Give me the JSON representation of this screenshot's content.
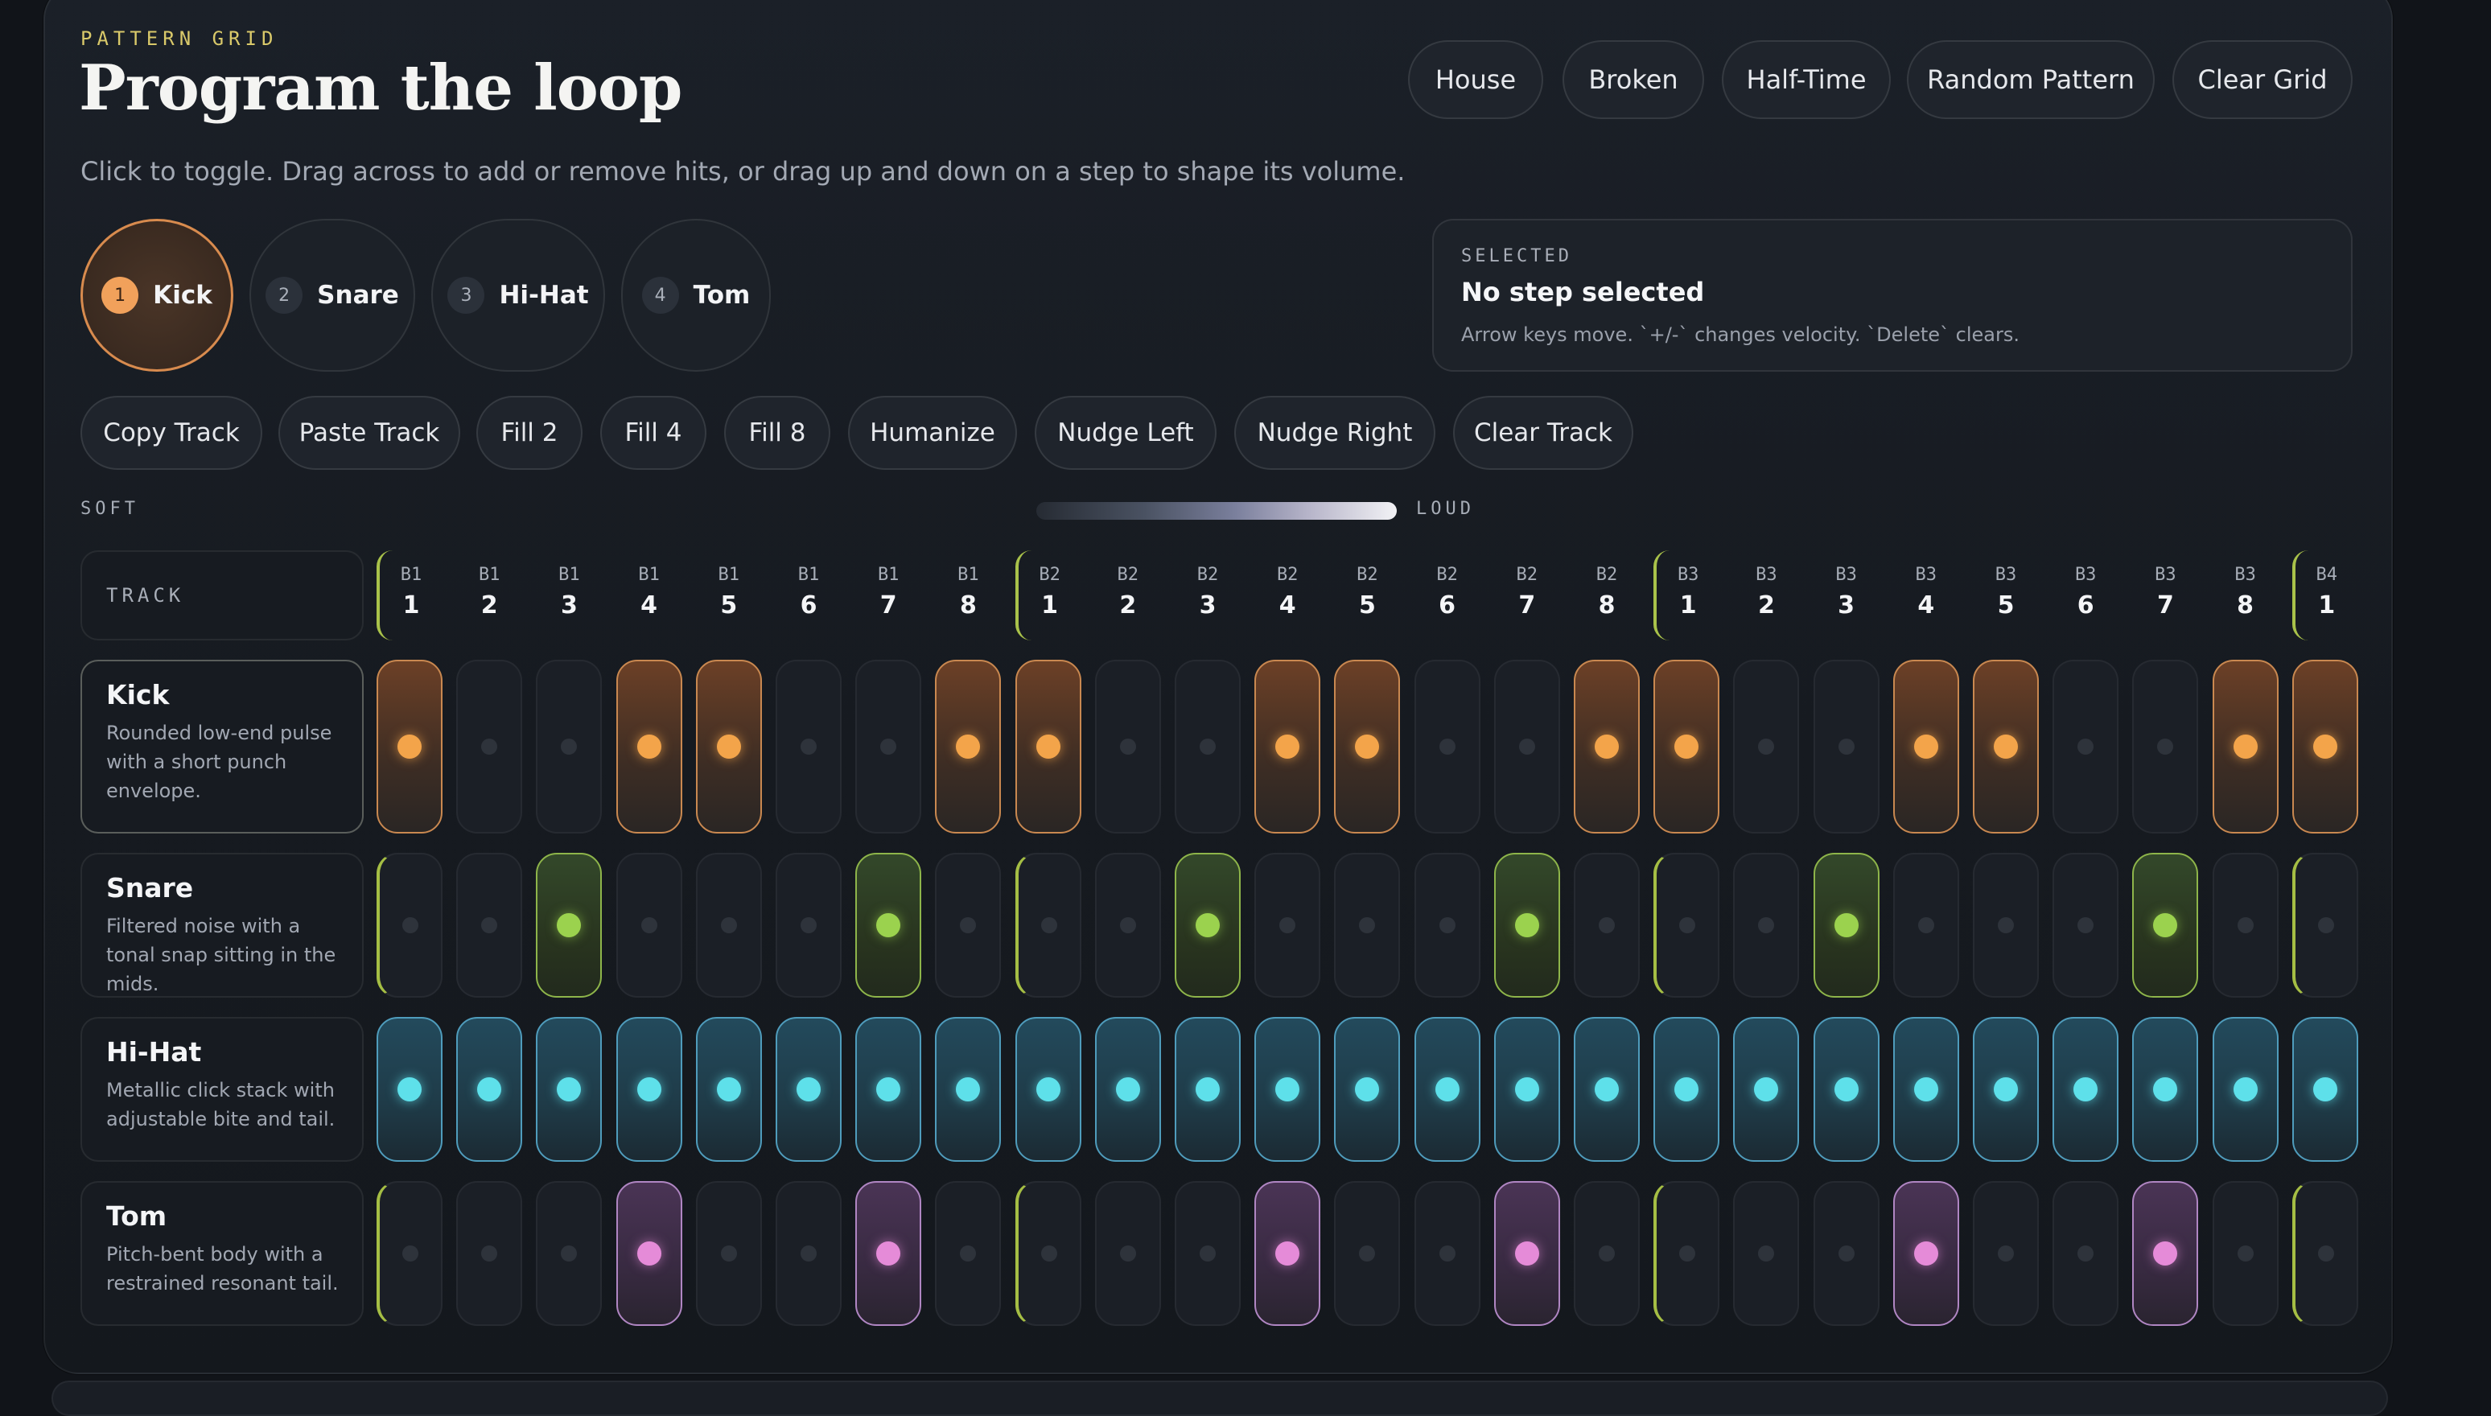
{
  "header": {
    "eyebrow": "PATTERN GRID",
    "title": "Program the loop",
    "subtitle": "Click to toggle. Drag across to add or remove hits, or drag up and down on a step to shape its volume."
  },
  "presets": [
    "House",
    "Broken",
    "Half-Time",
    "Random Pattern",
    "Clear Grid"
  ],
  "track_select": [
    {
      "num": "1",
      "label": "Kick",
      "active": true
    },
    {
      "num": "2",
      "label": "Snare",
      "active": false
    },
    {
      "num": "3",
      "label": "Hi-Hat",
      "active": false
    },
    {
      "num": "4",
      "label": "Tom",
      "active": false
    }
  ],
  "selected": {
    "eyebrow": "SELECTED",
    "title": "No step selected",
    "hint": "Arrow keys move. `+/-` changes velocity. `Delete` clears."
  },
  "track_actions": [
    "Copy Track",
    "Paste Track",
    "Fill 2",
    "Fill 4",
    "Fill 8",
    "Humanize",
    "Nudge Left",
    "Nudge Right",
    "Clear Track"
  ],
  "velocity": {
    "soft_label": "SOFT",
    "loud_label": "LOUD"
  },
  "grid_header_label": "TRACK",
  "steps": [
    {
      "bar": "B1",
      "step": "1"
    },
    {
      "bar": "B1",
      "step": "2"
    },
    {
      "bar": "B1",
      "step": "3"
    },
    {
      "bar": "B1",
      "step": "4"
    },
    {
      "bar": "B1",
      "step": "5"
    },
    {
      "bar": "B1",
      "step": "6"
    },
    {
      "bar": "B1",
      "step": "7"
    },
    {
      "bar": "B1",
      "step": "8"
    },
    {
      "bar": "B2",
      "step": "1"
    },
    {
      "bar": "B2",
      "step": "2"
    },
    {
      "bar": "B2",
      "step": "3"
    },
    {
      "bar": "B2",
      "step": "4"
    },
    {
      "bar": "B2",
      "step": "5"
    },
    {
      "bar": "B2",
      "step": "6"
    },
    {
      "bar": "B2",
      "step": "7"
    },
    {
      "bar": "B2",
      "step": "8"
    },
    {
      "bar": "B3",
      "step": "1"
    },
    {
      "bar": "B3",
      "step": "2"
    },
    {
      "bar": "B3",
      "step": "3"
    },
    {
      "bar": "B3",
      "step": "4"
    },
    {
      "bar": "B3",
      "step": "5"
    },
    {
      "bar": "B3",
      "step": "6"
    },
    {
      "bar": "B3",
      "step": "7"
    },
    {
      "bar": "B3",
      "step": "8"
    },
    {
      "bar": "B4",
      "step": "1"
    }
  ],
  "tracks": [
    {
      "name": "Kick",
      "key": "kick",
      "description": "Rounded low-end pulse with a short punch envelope.",
      "active": true,
      "pattern": [
        1,
        0,
        0,
        1,
        1,
        0,
        0,
        1,
        1,
        0,
        0,
        1,
        1,
        0,
        0,
        1,
        1,
        0,
        0,
        1,
        1,
        0,
        0,
        1,
        1
      ]
    },
    {
      "name": "Snare",
      "key": "snare",
      "description": "Filtered noise with a tonal snap sitting in the mids.",
      "active": false,
      "pattern": [
        0,
        0,
        1,
        0,
        0,
        0,
        1,
        0,
        0,
        0,
        1,
        0,
        0,
        0,
        1,
        0,
        0,
        0,
        1,
        0,
        0,
        0,
        1,
        0,
        0
      ]
    },
    {
      "name": "Hi-Hat",
      "key": "hat",
      "description": "Metallic click stack with adjustable bite and tail.",
      "active": false,
      "pattern": [
        1,
        1,
        1,
        1,
        1,
        1,
        1,
        1,
        1,
        1,
        1,
        1,
        1,
        1,
        1,
        1,
        1,
        1,
        1,
        1,
        1,
        1,
        1,
        1,
        1
      ]
    },
    {
      "name": "Tom",
      "key": "tom",
      "description": "Pitch-bent body with a restrained resonant tail.",
      "active": false,
      "pattern": [
        0,
        0,
        0,
        1,
        0,
        0,
        1,
        0,
        0,
        0,
        0,
        1,
        0,
        0,
        1,
        0,
        0,
        0,
        0,
        1,
        0,
        0,
        1,
        0,
        0
      ]
    }
  ]
}
